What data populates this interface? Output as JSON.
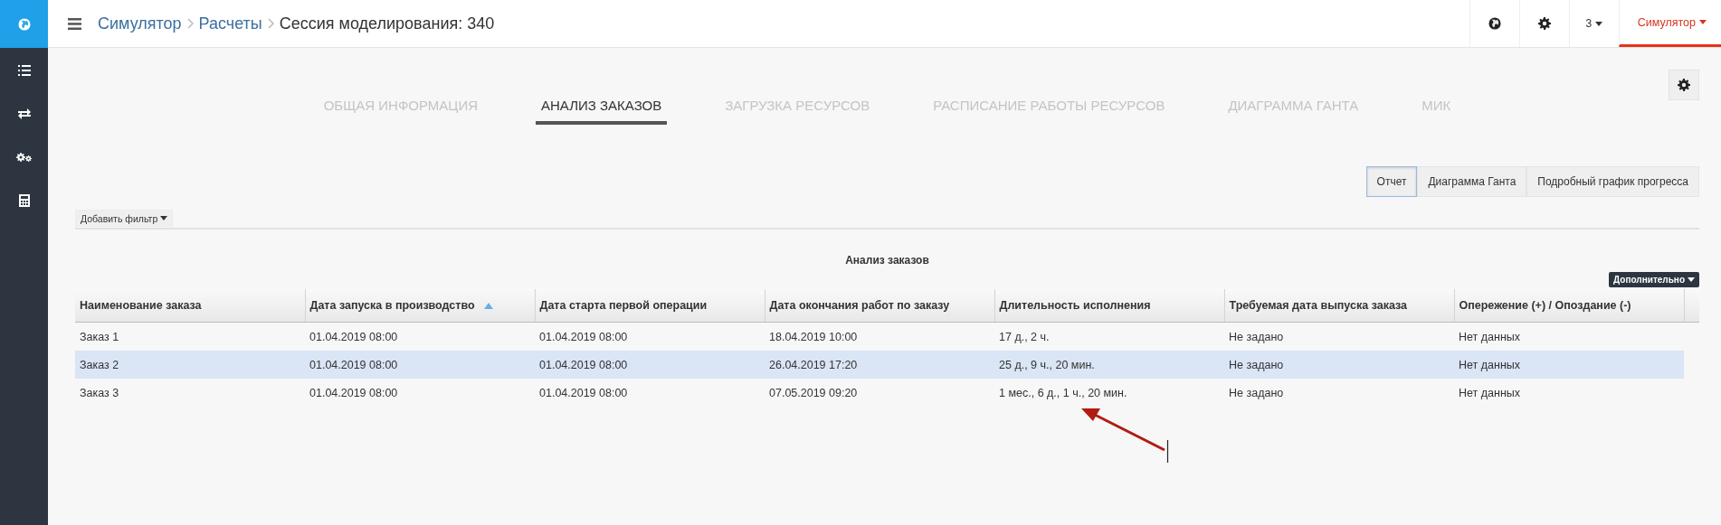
{
  "breadcrumbs": [
    {
      "label": "Симулятор",
      "kind": "link"
    },
    {
      "label": "Расчеты",
      "kind": "link"
    },
    {
      "label": "Сессия моделирования: 340",
      "kind": "current"
    }
  ],
  "topbar": {
    "counter": "3",
    "user": "Симулятор"
  },
  "tabs": [
    {
      "label": "ОБЩАЯ ИНФОРМАЦИЯ",
      "selected": false
    },
    {
      "label": "АНАЛИЗ ЗАКАЗОВ",
      "selected": true
    },
    {
      "label": "ЗАГРУЗКА РЕСУРСОВ",
      "selected": false
    },
    {
      "label": "РАСПИСАНИЕ РАБОТЫ РЕСУРСОВ",
      "selected": false
    },
    {
      "label": "ДИАГРАММА ГАНТА",
      "selected": false
    },
    {
      "label": "МИК",
      "selected": false
    }
  ],
  "view_buttons": [
    {
      "label": "Отчет",
      "selected": true
    },
    {
      "label": "Диаграмма Ганта",
      "selected": false
    },
    {
      "label": "Подробный график прогресса",
      "selected": false
    }
  ],
  "filter_button": "Добавить фильтр",
  "report": {
    "title": "Анализ заказов",
    "more_button": "Дополнительно",
    "columns": [
      {
        "label": "Наименование заказа"
      },
      {
        "label": "Дата запуска в производство",
        "sort_ascending": true
      },
      {
        "label": "Дата старта первой операции"
      },
      {
        "label": "Дата окончания работ по заказу"
      },
      {
        "label": "Длительность исполнения"
      },
      {
        "label": "Требуемая дата выпуска заказа"
      },
      {
        "label": "Опережение (+) / Опоздание (-)"
      }
    ],
    "rows": [
      {
        "selected": false,
        "cells": [
          "Заказ 1",
          "01.04.2019 08:00",
          "01.04.2019 08:00",
          "18.04.2019 10:00",
          "17 д., 2 ч.",
          "Не задано",
          "Нет данных"
        ]
      },
      {
        "selected": true,
        "cells": [
          "Заказ 2",
          "01.04.2019 08:00",
          "01.04.2019 08:00",
          "26.04.2019 17:20",
          "25 д., 9 ч., 20 мин.",
          "Не задано",
          "Нет данных"
        ]
      },
      {
        "selected": false,
        "cells": [
          "Заказ 3",
          "01.04.2019 08:00",
          "01.04.2019 08:00",
          "07.05.2019 09:20",
          "1 мес., 6 д., 1 ч., 20 мин.",
          "Не задано",
          "Нет данных"
        ]
      }
    ]
  }
}
